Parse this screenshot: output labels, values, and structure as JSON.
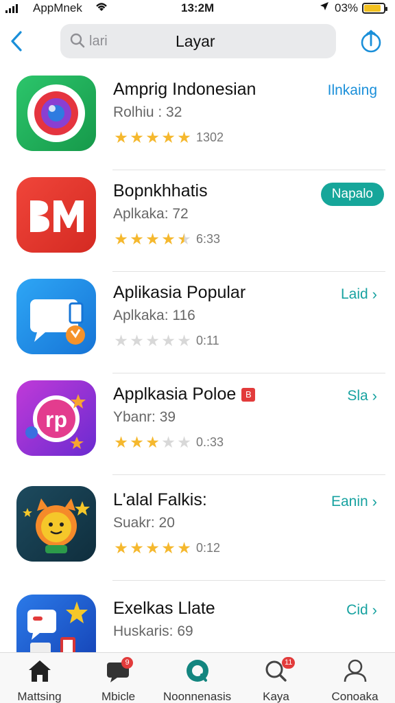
{
  "status_bar": {
    "carrier": "AppMnek",
    "time": "13:2M",
    "battery": "03%"
  },
  "header": {
    "search_placeholder": "lari",
    "title": "Layar"
  },
  "apps": [
    {
      "name": "Amprig Indonesian",
      "subtitle": "Rolhiu : 32",
      "rating": 5,
      "review_count": "1302",
      "action": "Ilnkaing",
      "action_style": "blue",
      "icon": "camera-lens-icon",
      "icon_color": "#1db954"
    },
    {
      "name": "Bopnkhhatis",
      "subtitle": "Aplkaka: 72",
      "rating": 4.5,
      "review_count": "6:33",
      "action": "Napalo",
      "action_style": "pill",
      "icon": "bm-logo-icon",
      "icon_color": "#e8322b"
    },
    {
      "name": "Aplikasia Popular",
      "subtitle": "Aplkaka: 116",
      "rating": 0,
      "review_count": "0:11",
      "action": "Laid",
      "action_style": "link",
      "icon": "chat-window-icon",
      "icon_color": "#1e8fe8"
    },
    {
      "name": "Applkasia Poloe",
      "subtitle": "Ybanr: 39",
      "rating": 3,
      "review_count": "0.:33",
      "action": "Sla",
      "action_style": "link",
      "icon": "rp-badge-icon",
      "icon_color": "#8e35d6",
      "tag": "B"
    },
    {
      "name": "L'alal Falkis:",
      "subtitle": "Suakr: 20",
      "rating": 5,
      "review_count": "0:12",
      "action": "Eanin",
      "action_style": "link",
      "icon": "cartoon-cat-icon",
      "icon_color": "#163a4e"
    },
    {
      "name": "Exelkas Llate",
      "subtitle": "Huskaris: 69",
      "rating": 0,
      "review_count": "",
      "action": "Cid",
      "action_style": "link",
      "icon": "devices-star-icon",
      "icon_color": "#1f5fd1"
    }
  ],
  "tabs": [
    {
      "label": "Mattsing",
      "icon": "home-icon",
      "badge": ""
    },
    {
      "label": "Mbicle",
      "icon": "chat-bubble-icon",
      "badge": "9"
    },
    {
      "label": "Noonnenasis",
      "icon": "discover-icon",
      "badge": ""
    },
    {
      "label": "Kaya",
      "icon": "search-icon",
      "badge": "11"
    },
    {
      "label": "Conoaka",
      "icon": "profile-icon",
      "badge": ""
    }
  ],
  "colors": {
    "accent": "#17a2a0",
    "link_blue": "#1a8fd9",
    "star": "#f5b82e",
    "star_empty": "#d8d8d8"
  }
}
